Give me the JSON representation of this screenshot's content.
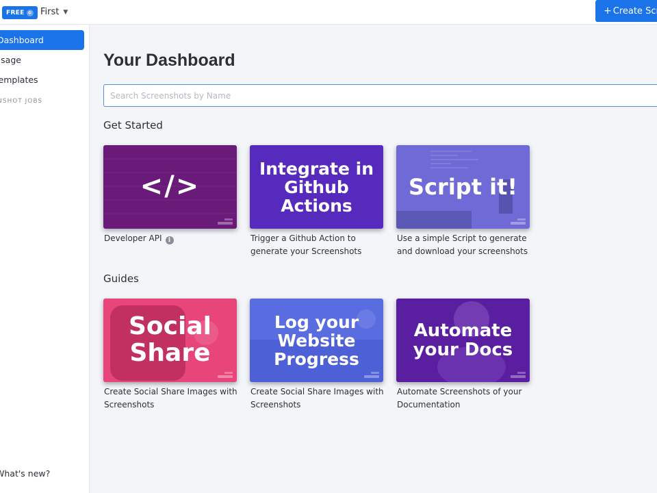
{
  "topbar": {
    "plan_badge": "FREE",
    "workspace_name": "First",
    "create_button": "Create Scre"
  },
  "sidebar": {
    "items": [
      {
        "label": "Dashboard",
        "active": true
      },
      {
        "label": "Usage",
        "active": false
      },
      {
        "label": "Templates",
        "active": false
      }
    ],
    "section_label": "SCREENSHOT JOBS",
    "section_label_visible": "NSHOT JOBS",
    "whats_new": "What's new?"
  },
  "main": {
    "title": "Your Dashboard",
    "search_placeholder": "Search Screenshots by Name",
    "get_started": {
      "heading": "Get Started",
      "cards": [
        {
          "image_text": "</>",
          "caption": "Developer API",
          "has_info_icon": true,
          "color": "#6a1b7a"
        },
        {
          "image_text": "Integrate in Github Actions",
          "caption": "Trigger a Github Action to generate your Screenshots",
          "has_info_icon": false,
          "color": "#4a24b3"
        },
        {
          "image_text": "Script it!",
          "caption": "Use a simple Script to generate and download your screenshots",
          "has_info_icon": false,
          "color": "#6f6ad6"
        }
      ]
    },
    "guides": {
      "heading": "Guides",
      "cards": [
        {
          "image_text": "Social Share",
          "caption": "Create Social Share Images with Screenshots",
          "color": "#e8457a"
        },
        {
          "image_text": "Log your Website Progress",
          "caption": "Create Social Share Images with Screenshots",
          "color": "#5a6de0"
        },
        {
          "image_text": "Automate your Docs",
          "caption": "Automate Screenshots of your Documentation",
          "color": "#5a1ea0"
        }
      ]
    }
  },
  "colors": {
    "accent": "#1a73e8",
    "background": "#f4f5f8"
  }
}
